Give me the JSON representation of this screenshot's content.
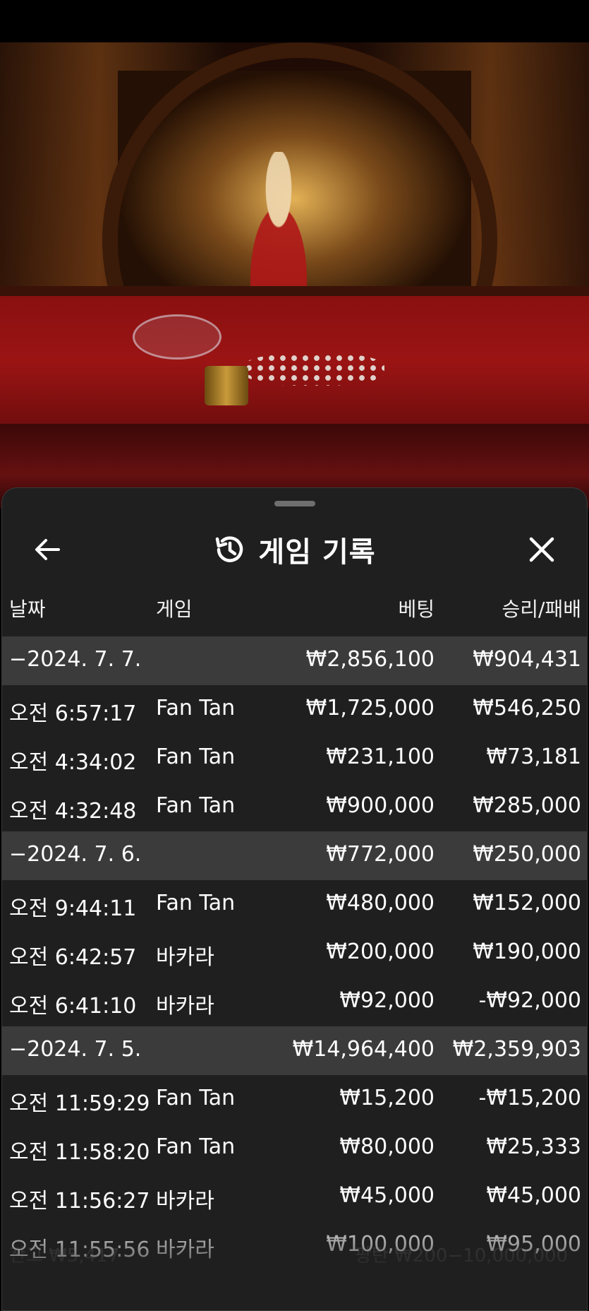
{
  "header": {
    "title": "게임 기록",
    "back_icon": "arrow-left-icon",
    "history_icon": "history-icon",
    "close_icon": "close-icon"
  },
  "columns": {
    "date": "날짜",
    "game": "게임",
    "bet": "베팅",
    "winloss": "승리/패배"
  },
  "days": [
    {
      "date": "−2024. 7. 7.",
      "bet": "₩2,856,100",
      "winloss": "₩904,431",
      "rows": [
        {
          "time": "오전 6:57:17",
          "game": "Fan Tan",
          "bet": "₩1,725,000",
          "winloss": "₩546,250"
        },
        {
          "time": "오전 4:34:02",
          "game": "Fan Tan",
          "bet": "₩231,100",
          "winloss": "₩73,181"
        },
        {
          "time": "오전 4:32:48",
          "game": "Fan Tan",
          "bet": "₩900,000",
          "winloss": "₩285,000"
        }
      ]
    },
    {
      "date": "−2024. 7. 6.",
      "bet": "₩772,000",
      "winloss": "₩250,000",
      "rows": [
        {
          "time": "오전 9:44:11",
          "game": "Fan Tan",
          "bet": "₩480,000",
          "winloss": "₩152,000"
        },
        {
          "time": "오전 6:42:57",
          "game": "바카라",
          "bet": "₩200,000",
          "winloss": "₩190,000"
        },
        {
          "time": "오전 6:41:10",
          "game": "바카라",
          "bet": "₩92,000",
          "winloss": "-₩92,000"
        }
      ]
    },
    {
      "date": "−2024. 7. 5.",
      "bet": "₩14,964,400",
      "winloss": "₩2,359,903",
      "rows": [
        {
          "time": "오전 11:59:29",
          "game": "Fan Tan",
          "bet": "₩15,200",
          "winloss": "-₩15,200"
        },
        {
          "time": "오전 11:58:20",
          "game": "Fan Tan",
          "bet": "₩80,000",
          "winloss": "₩25,333"
        },
        {
          "time": "오전 11:56:27",
          "game": "바카라",
          "bet": "₩45,000",
          "winloss": "₩45,000"
        },
        {
          "time": "오전 11:55:56",
          "game": "바카라",
          "bet": "₩100,000",
          "winloss": "₩95,000"
        }
      ]
    }
  ],
  "background_ui": {
    "balance": "잔고 ₩5,417",
    "bet_limits": "팡탄 ₩200−10,000,000"
  }
}
